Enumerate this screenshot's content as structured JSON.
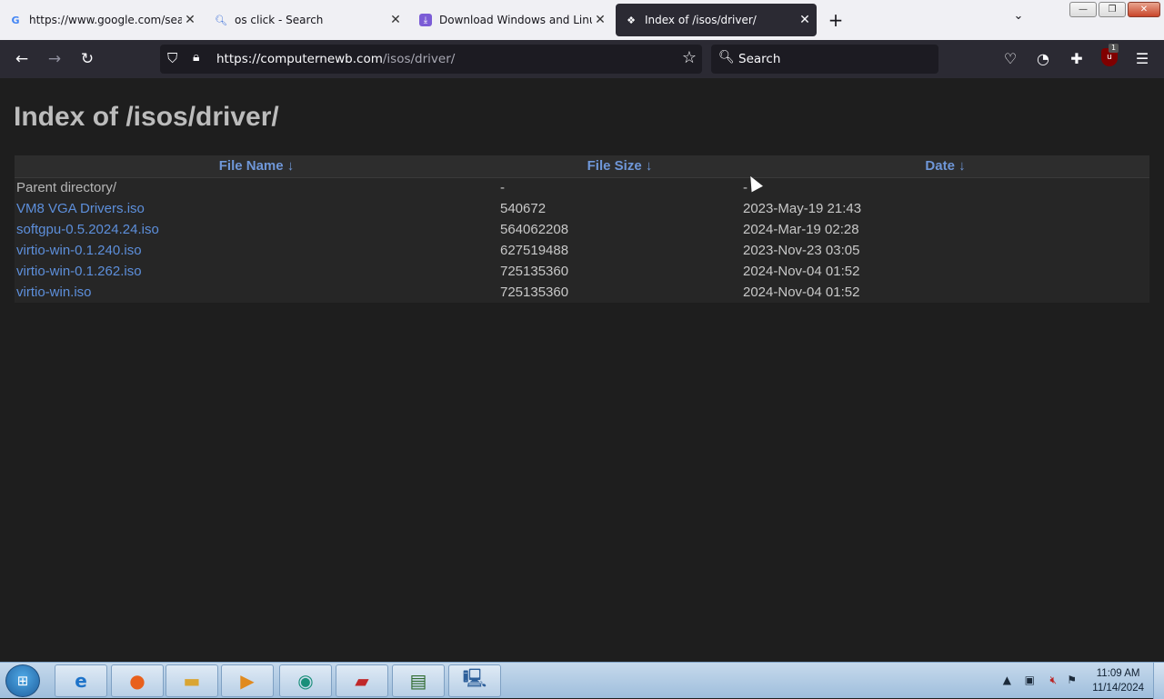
{
  "tabs": [
    {
      "title": "https://www.google.com/search?",
      "icon": "google-icon"
    },
    {
      "title": "os click - Search",
      "icon": "search-icon"
    },
    {
      "title": "Download Windows and Linux ISO",
      "icon": "download-icon"
    },
    {
      "title": "Index of /isos/driver/",
      "icon": "site-icon",
      "active": true
    }
  ],
  "window_controls": {
    "minimize": "—",
    "restore": "❐",
    "close": "✕"
  },
  "navbar": {
    "url_domain": "https://computernewb.com",
    "url_path": "/isos/driver/",
    "search_placeholder": "Search"
  },
  "extensions": {
    "ublock_badge": "1"
  },
  "page": {
    "title": "Index of /isos/driver/",
    "columns": {
      "name": "File Name  ↓",
      "size": "File Size  ↓",
      "date": "Date  ↓"
    },
    "rows": [
      {
        "name": "Parent directory/",
        "size": "-",
        "date": "-",
        "link": false
      },
      {
        "name": "VM8 VGA Drivers.iso",
        "size": "540672",
        "date": "2023-May-19 21:43",
        "link": true
      },
      {
        "name": "softgpu-0.5.2024.24.iso",
        "size": "564062208",
        "date": "2024-Mar-19 02:28",
        "link": true
      },
      {
        "name": "virtio-win-0.1.240.iso",
        "size": "627519488",
        "date": "2023-Nov-23 03:05",
        "link": true
      },
      {
        "name": "virtio-win-0.1.262.iso",
        "size": "725135360",
        "date": "2024-Nov-04 01:52",
        "link": true
      },
      {
        "name": "virtio-win.iso",
        "size": "725135360",
        "date": "2024-Nov-04 01:52",
        "link": true
      }
    ]
  },
  "taskbar": {
    "apps": [
      "internet-explorer-icon",
      "firefox-icon",
      "file-explorer-icon",
      "media-player-icon",
      "app-icon",
      "toolbox-icon",
      "terminal-icon",
      "computer-icon"
    ],
    "clock_time": "11:09 AM",
    "clock_date": "11/14/2024"
  },
  "colors": {
    "link": "#5d8fdb",
    "header": "#6f97d8",
    "background": "#1e1e1e"
  }
}
